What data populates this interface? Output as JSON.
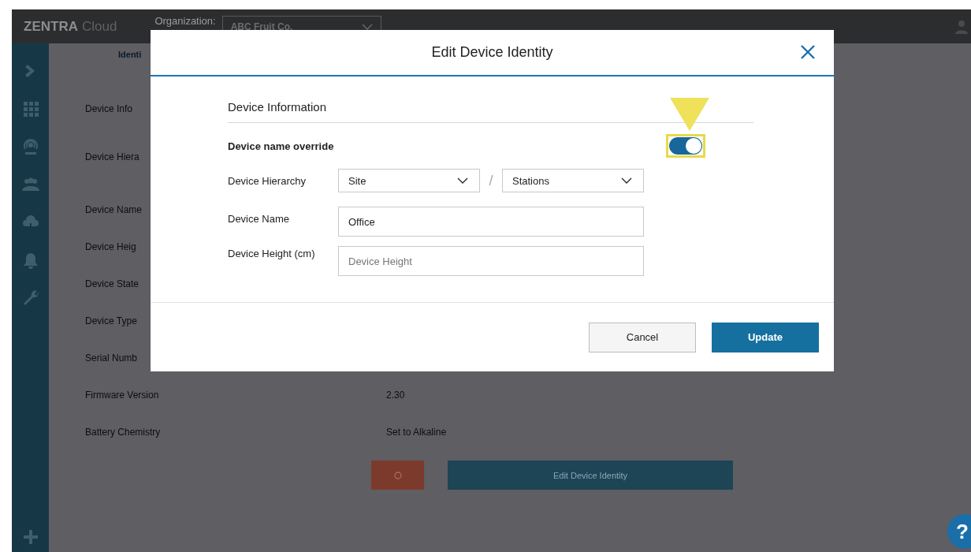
{
  "topbar": {
    "brand": "ZENTRA",
    "brand_suffix": "Cloud",
    "organization_label": "Organization:",
    "organization": "ABC Fruit Co."
  },
  "background": {
    "tab": "Identi",
    "section": "Device Info",
    "rows": [
      {
        "label": "Device Hiera"
      },
      {
        "label": "Device Name"
      },
      {
        "label": "Device Heig"
      },
      {
        "label": "Device State"
      },
      {
        "label": "Device Type"
      },
      {
        "label": "Serial Numb"
      },
      {
        "label": "Firmware Version",
        "value": "2.30"
      },
      {
        "label": "Battery Chemistry",
        "value": "Set to Alkaline"
      }
    ],
    "edit_button": "Edit Device Identity"
  },
  "dialog": {
    "title": "Edit Device Identity",
    "section": "Device Information",
    "override": {
      "label": "Device name override",
      "on": true
    },
    "hierarchy": {
      "label": "Device Hierarchy",
      "site": "Site",
      "separator": "/",
      "station": "Stations"
    },
    "name": {
      "label": "Device Name",
      "value": "Office"
    },
    "height": {
      "label": "Device Height (cm)",
      "placeholder": "Device Height"
    },
    "buttons": [
      {
        "label": "Cancel",
        "kind": "secondary"
      },
      {
        "label": "Update",
        "kind": "primary"
      }
    ]
  },
  "help": "?"
}
